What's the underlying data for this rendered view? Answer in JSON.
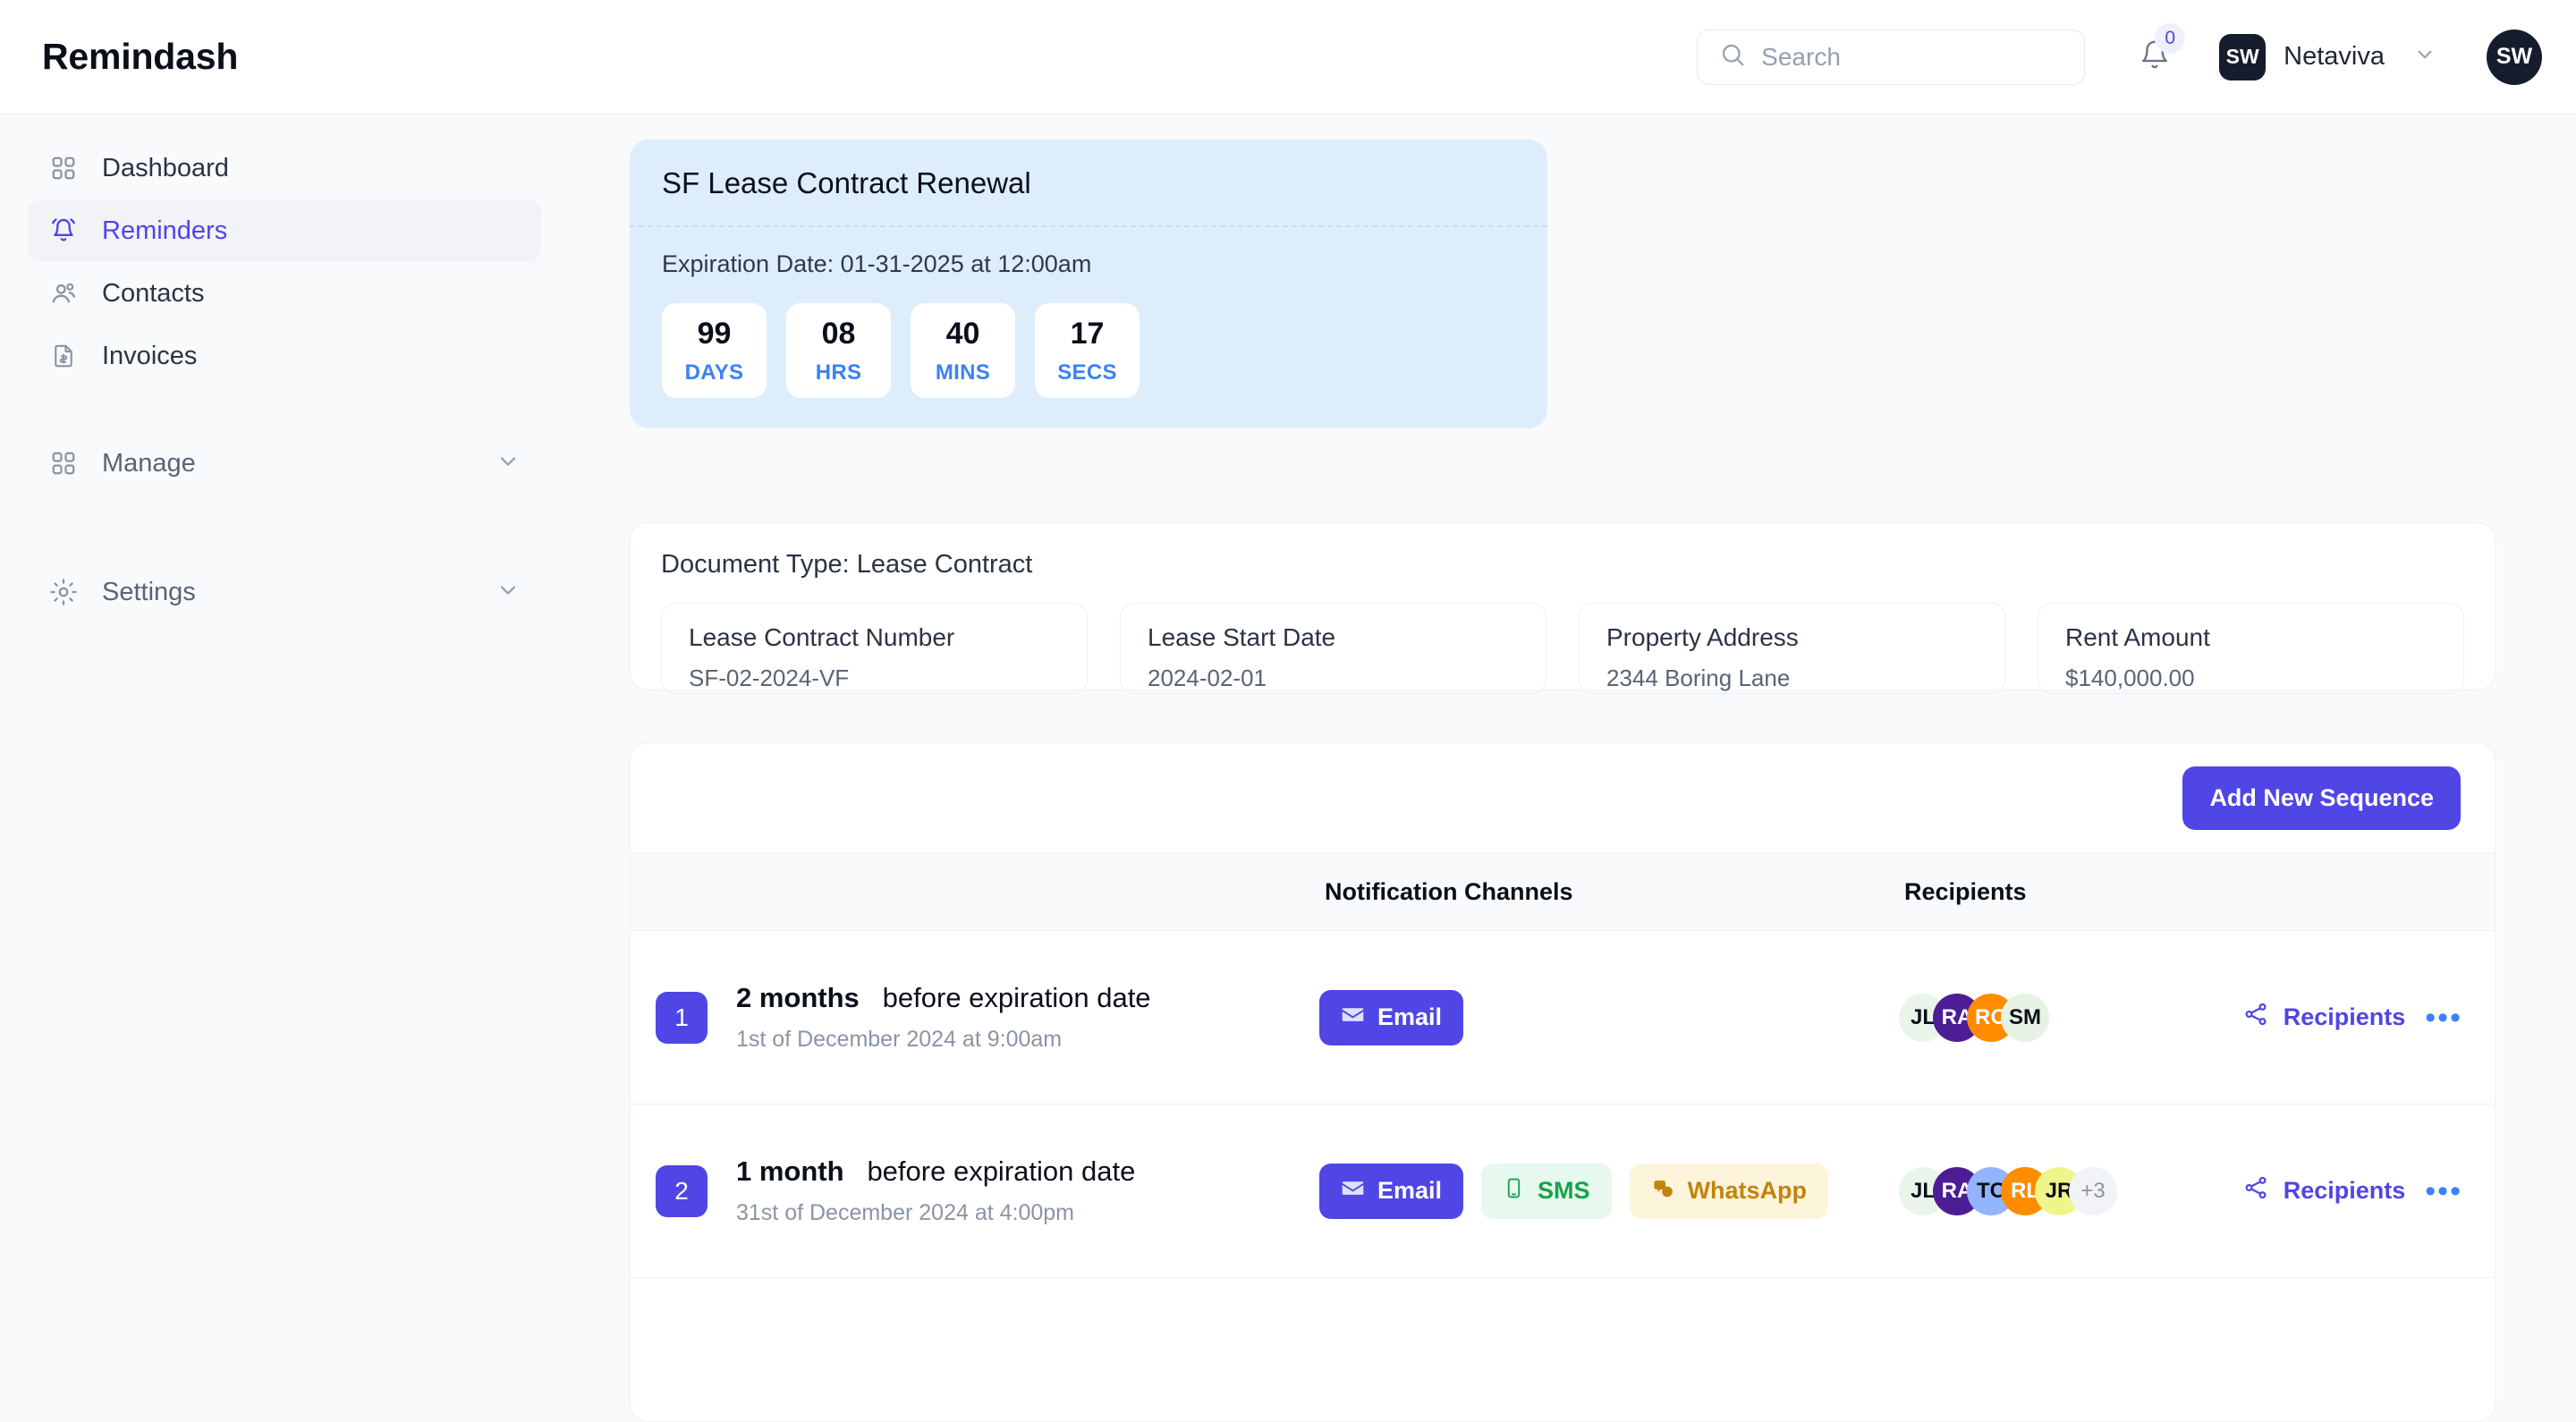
{
  "header": {
    "brand": "Remindash",
    "search": {
      "placeholder": "Search",
      "value": ""
    },
    "notifications_count": "0",
    "org": {
      "initials": "SW",
      "name": "Netaviva"
    },
    "user": {
      "initials": "SW"
    }
  },
  "sidebar": {
    "items": [
      {
        "label": "Dashboard",
        "icon": "grid-icon",
        "active": false,
        "expandable": false
      },
      {
        "label": "Reminders",
        "icon": "bell-icon",
        "active": true,
        "expandable": false
      },
      {
        "label": "Contacts",
        "icon": "users-icon",
        "active": false,
        "expandable": false
      },
      {
        "label": "Invoices",
        "icon": "invoice-icon",
        "active": false,
        "expandable": false
      }
    ],
    "groups": [
      {
        "label": "Manage",
        "icon": "grid-icon",
        "expandable": true
      },
      {
        "label": "Settings",
        "icon": "gear-icon",
        "expandable": true
      }
    ]
  },
  "countdown": {
    "title": "SF Lease Contract Renewal",
    "expiration_label": "Expiration Date: 01-31-2025 at 12:00am",
    "units": [
      {
        "value": "99",
        "unit": "DAYS"
      },
      {
        "value": "08",
        "unit": "HRS"
      },
      {
        "value": "40",
        "unit": "MINS"
      },
      {
        "value": "17",
        "unit": "SECS"
      }
    ]
  },
  "document": {
    "title": "Document Type: Lease Contract",
    "fields": [
      {
        "key": "Lease Contract Number",
        "value": "SF-02-2024-VF"
      },
      {
        "key": "Lease Start Date",
        "value": "2024-02-01"
      },
      {
        "key": "Property Address",
        "value": "2344 Boring Lane"
      },
      {
        "key": "Rent Amount",
        "value": "$140,000.00"
      }
    ]
  },
  "sequences": {
    "add_button": "Add New Sequence",
    "columns": {
      "channels": "Notification Channels",
      "recipients": "Recipients"
    },
    "recipients_action": "Recipients",
    "more_action": "•••",
    "rows": [
      {
        "order": "1",
        "offset": "2 months",
        "offset_suffix": "before expiration date",
        "scheduled": "1st of December 2024 at 9:00am",
        "channels": [
          {
            "label": "Email",
            "type": "email",
            "icon": "envelope-icon"
          }
        ],
        "avatars": [
          {
            "initials": "JL",
            "bg": "#eaf5e9",
            "fg": "#0b0f19"
          },
          {
            "initials": "RA",
            "bg": "#4c1d95",
            "fg": "#ffffff"
          },
          {
            "initials": "RO",
            "bg": "#ff8c00",
            "fg": "#ffffff"
          },
          {
            "initials": "SM",
            "bg": "#e6f2e4",
            "fg": "#0b0f19"
          }
        ],
        "overflow": ""
      },
      {
        "order": "2",
        "offset": "1 month",
        "offset_suffix": "before expiration date",
        "scheduled": "31st of December 2024 at 4:00pm",
        "channels": [
          {
            "label": "Email",
            "type": "email",
            "icon": "envelope-icon"
          },
          {
            "label": "SMS",
            "type": "sms",
            "icon": "phone-icon"
          },
          {
            "label": "WhatsApp",
            "type": "whatsapp",
            "icon": "whatsapp-icon"
          }
        ],
        "avatars": [
          {
            "initials": "JL",
            "bg": "#eaf5e9",
            "fg": "#0b0f19"
          },
          {
            "initials": "RA",
            "bg": "#4c1d95",
            "fg": "#ffffff"
          },
          {
            "initials": "TC",
            "bg": "#93b4fc",
            "fg": "#0b0f19"
          },
          {
            "initials": "RL",
            "bg": "#ff8c00",
            "fg": "#ffffff"
          },
          {
            "initials": "JR",
            "bg": "#f0f58a",
            "fg": "#0b0f19"
          }
        ],
        "overflow": "+3"
      }
    ]
  },
  "colors": {
    "accent": "#4f46e5",
    "card_blue": "#ddedfc",
    "timer_blue": "#3b82f6",
    "page_bg": "#f8fafc"
  }
}
